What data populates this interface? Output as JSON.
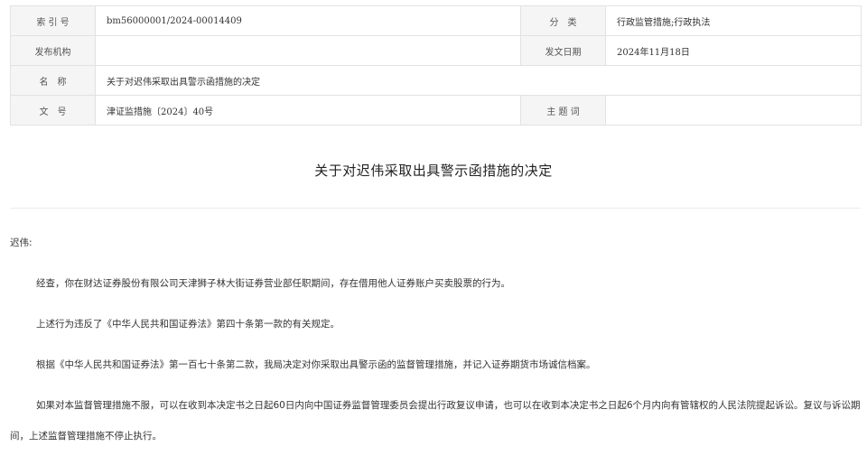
{
  "meta": {
    "index_label": "索 引 号",
    "index_value": "bm56000001/2024-00014409",
    "category_label": "分　类",
    "category_value": "行政监管措施;行政执法",
    "issuer_label": "发布机构",
    "issuer_value": "",
    "date_label": "发文日期",
    "date_value": "2024年11月18日",
    "name_label": "名　称",
    "name_value": "关于对迟伟采取出具警示函措施的决定",
    "docno_label": "文　号",
    "docno_value": "津证监措施〔2024〕40号",
    "keywords_label": "主 题 词",
    "keywords_value": ""
  },
  "document": {
    "title": "关于对迟伟采取出具警示函措施的决定",
    "salutation": "迟伟:",
    "paragraphs": [
      "经查，你在财达证券股份有限公司天津狮子林大街证券营业部任职期间，存在借用他人证券账户买卖股票的行为。",
      "上述行为违反了《中华人民共和国证券法》第四十条第一款的有关规定。",
      "根据《中华人民共和国证券法》第一百七十条第二款，我局决定对你采取出具警示函的监督管理措施，并记入证券期货市场诚信档案。",
      "如果对本监督管理措施不服，可以在收到本决定书之日起60日内向中国证券监督管理委员会提出行政复议申请，也可以在收到本决定书之日起6个月内向有管辖权的人民法院提起诉讼。复议与诉讼期间，上述监督管理措施不停止执行。"
    ]
  }
}
